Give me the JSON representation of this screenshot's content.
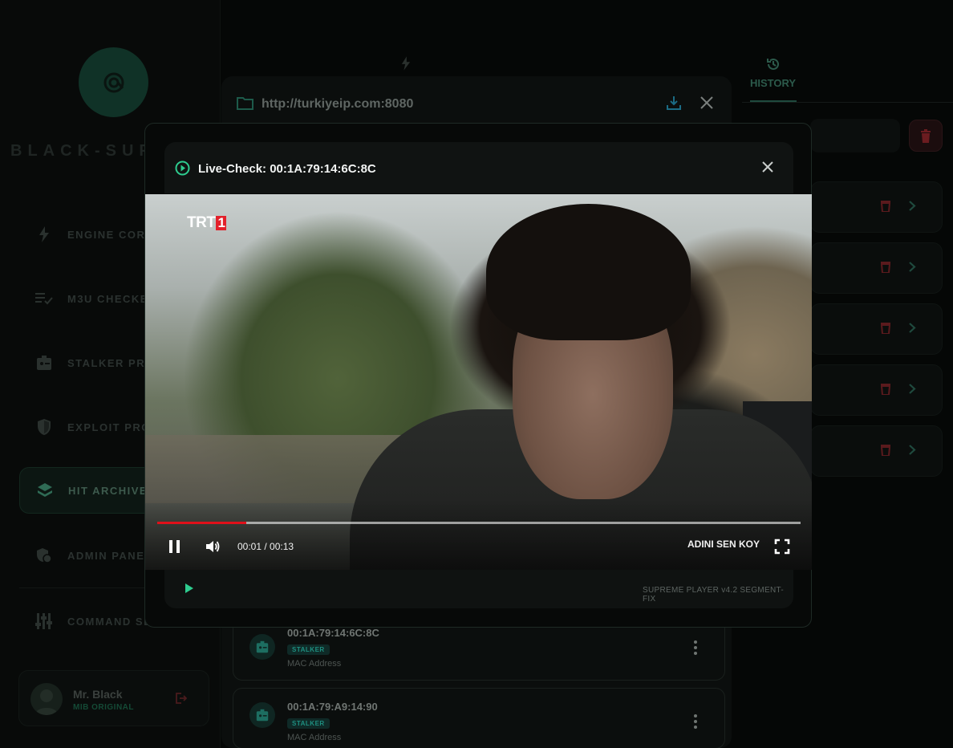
{
  "sidebar": {
    "brand": "BLACK-SUP",
    "nav": [
      {
        "label": "ENGINE CORE",
        "icon": "bolt-icon"
      },
      {
        "label": "M3U CHECKE",
        "icon": "checklist-icon"
      },
      {
        "label": "STALKER PRO",
        "icon": "id-badge-icon"
      },
      {
        "label": "EXPLOIT PRO",
        "icon": "shield-icon"
      },
      {
        "label": "HIT ARCHIVE",
        "icon": "layers-icon",
        "active": true
      },
      {
        "label": "ADMIN PANE",
        "icon": "admin-shield-icon"
      },
      {
        "label": "COMMAND SE",
        "icon": "sliders-icon"
      }
    ],
    "user": {
      "name": "Mr. Black",
      "role": "MIB ORIGINAL"
    }
  },
  "main": {
    "history_tab": "HISTORY"
  },
  "portal": {
    "url": "http://turkiyeip.com:8080",
    "results": [
      {
        "mac": "00:1A:79:14:6C:8C",
        "badge": "STALKER",
        "type": "MAC Address"
      },
      {
        "mac": "00:1A:79:A9:14:90",
        "badge": "STALKER",
        "type": "MAC Address"
      }
    ]
  },
  "modal": {
    "title": "Live-Check: 00:1A:79:14:6C:8C",
    "video": {
      "channel_logo": "TRT",
      "channel_logo_number": "1",
      "time": "00:01 / 00:13",
      "progress_fraction": 0.138,
      "channel_name": "ADINI SEN KOY"
    },
    "footer": {
      "version": "SUPREME PLAYER v4.2 SEGMENT-FIX"
    }
  },
  "colors": {
    "accent_green": "#2ecc8f",
    "danger_red": "#a8242b",
    "progress_red": "#e0101a"
  }
}
